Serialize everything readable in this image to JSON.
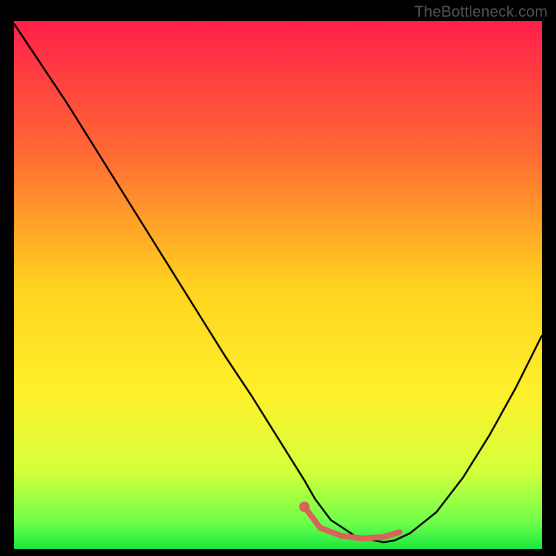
{
  "watermark": "TheBottleneck.com",
  "chart_data": {
    "type": "line",
    "title": "",
    "xlabel": "",
    "ylabel": "",
    "xlim": [
      0,
      100
    ],
    "ylim": [
      0,
      100
    ],
    "background_gradient": {
      "stops": [
        {
          "offset": 0.0,
          "color": "#ff1f4a"
        },
        {
          "offset": 0.25,
          "color": "#ff6a33"
        },
        {
          "offset": 0.5,
          "color": "#ffd21f"
        },
        {
          "offset": 0.7,
          "color": "#fff02a"
        },
        {
          "offset": 0.85,
          "color": "#d6ff3b"
        },
        {
          "offset": 0.95,
          "color": "#6eff4a"
        },
        {
          "offset": 1.0,
          "color": "#19e83f"
        }
      ]
    },
    "curve": {
      "name": "bottleneck",
      "color": "#000000",
      "x": [
        0,
        5,
        10,
        15,
        20,
        25,
        30,
        35,
        40,
        45,
        50,
        55,
        57,
        60,
        65,
        70,
        72,
        75,
        80,
        85,
        90,
        95,
        100
      ],
      "y": [
        99.5,
        92,
        84.5,
        76.5,
        68.5,
        60.5,
        52.5,
        44.5,
        36.5,
        29,
        21,
        13,
        9.5,
        5.5,
        2.2,
        1.3,
        1.6,
        3,
        7,
        13.5,
        21.5,
        30.5,
        40.5
      ]
    },
    "marker_segment": {
      "name": "optimal-range",
      "color": "#d9635a",
      "x": [
        55,
        58,
        62,
        66,
        70,
        73
      ],
      "y": [
        8.0,
        4.0,
        2.5,
        2.0,
        2.3,
        3.2
      ],
      "start_dot": {
        "x": 55,
        "y": 8.0,
        "r": 1.0
      }
    }
  }
}
